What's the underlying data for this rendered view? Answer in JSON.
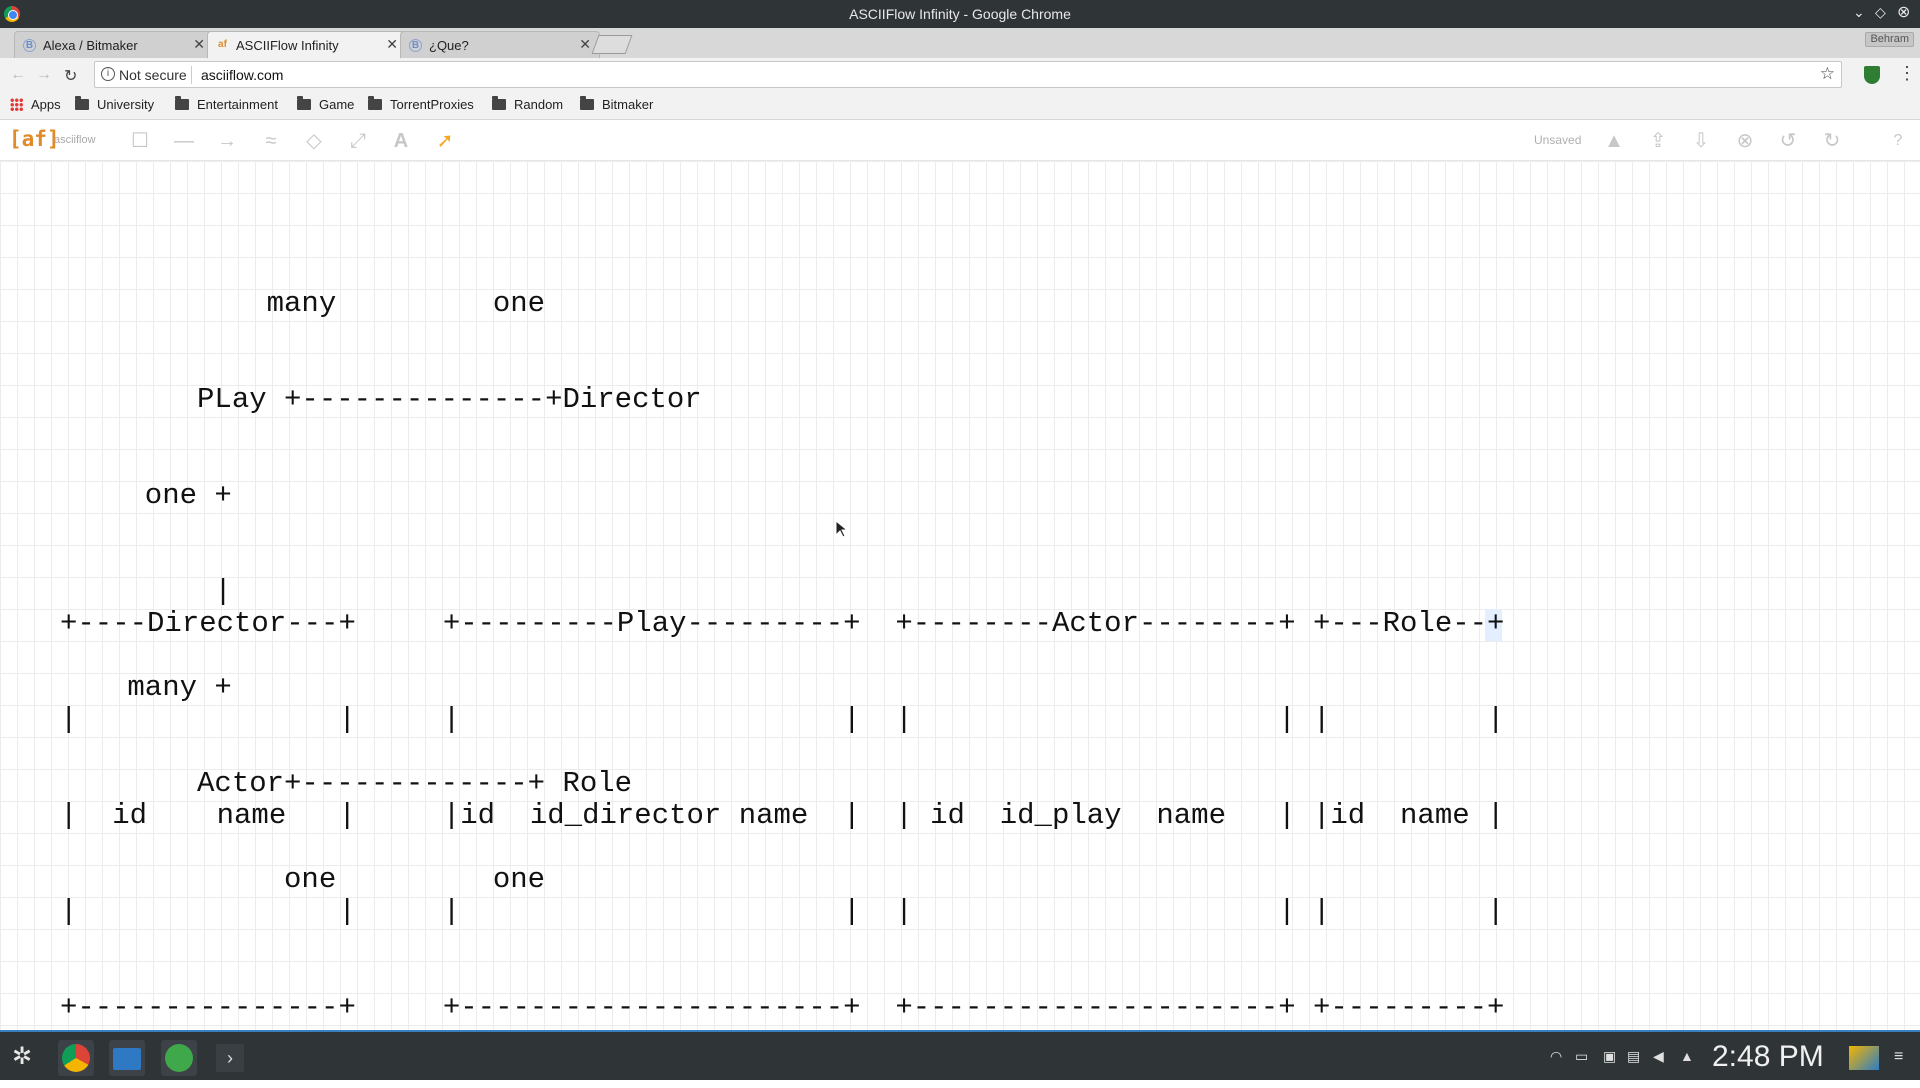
{
  "window": {
    "title": "ASCIIFlow Infinity - Google Chrome",
    "user": "Behram"
  },
  "tabs": [
    {
      "label": "Alexa / Bitmaker",
      "favicon": "B",
      "active": false
    },
    {
      "label": "ASCIIFlow Infinity",
      "favicon": "af",
      "active": true
    },
    {
      "label": "¿Que?",
      "favicon": "B",
      "active": false
    }
  ],
  "address": {
    "security": "Not secure",
    "url": "asciiflow.com"
  },
  "bookmarks": [
    "Apps",
    "University",
    "Entertainment",
    "Game",
    "TorrentProxies",
    "Random",
    "Bitmaker"
  ],
  "asciiflow": {
    "logo": "[af]",
    "name": "asciiflow",
    "status": "Unsaved"
  },
  "diagram": {
    "top": [
      "         many         one",
      "     PLay +--------------+Director",
      "  one +",
      "      |",
      " many +",
      "     Actor+-------------+ Role",
      "          one         one"
    ],
    "tables": [
      "+----Director---+     +---------Play---------+  +--------Actor--------+ +---Role--+",
      "|               |     |                      |  |                     | |         |",
      "|  id    name   |     |id  id_director name  |  | id  id_play  name   | |id  name |",
      "|               |     |                      |  |                     | |         |",
      "+---------------+     +----------------------+  +---------------------+ +---------+"
    ]
  },
  "taskbar": {
    "clock": "2:48 PM"
  },
  "colors": {
    "accent": "#e08a2a",
    "selected_tool": "#f5a623",
    "taskbar_border": "#3a7fc0"
  },
  "icons": [
    "chrome-icon",
    "file-manager-icon",
    "network-icon",
    "terminal-icon"
  ]
}
